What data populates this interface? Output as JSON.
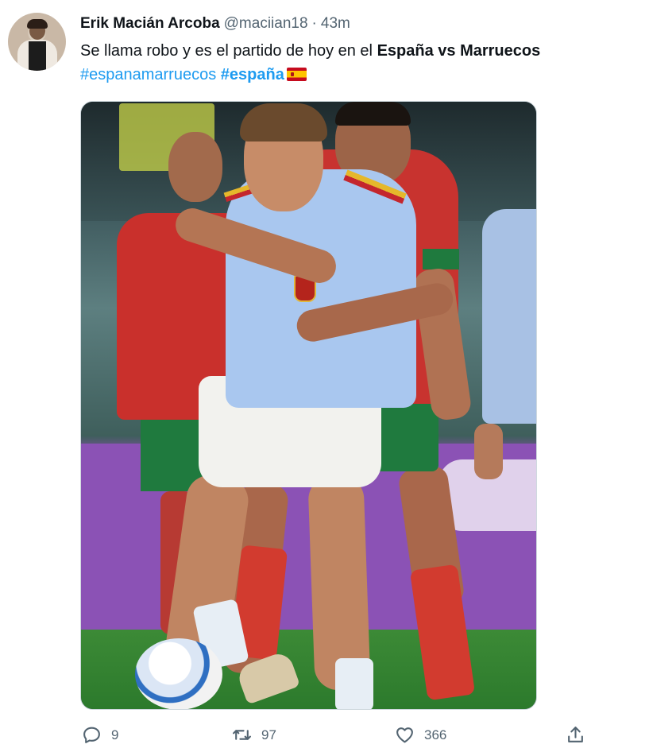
{
  "tweet": {
    "display_name": "Erik Macián Arcoba",
    "handle": "@maciian18",
    "separator": "·",
    "time": "43m",
    "text_line1_plain": "Se llama robo y es el partido de hoy en el ",
    "text_line1_bold": "España vs Marruecos",
    "hashtag1": "#espanamarruecos",
    "hashtag2": "#españa",
    "flag_icon": "spain-flag-icon"
  },
  "actions": {
    "reply_count": "9",
    "retweet_count": "97",
    "like_count": "366"
  },
  "colors": {
    "link": "#1d9bf0",
    "secondary_text": "#536471",
    "primary_text": "#0f1419"
  }
}
